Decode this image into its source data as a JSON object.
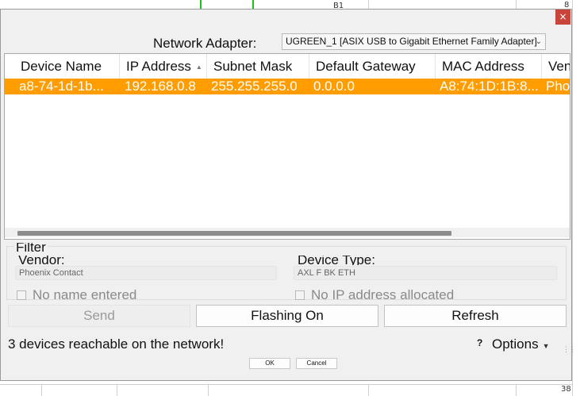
{
  "background": {
    "labels": [
      "B1",
      "8",
      "38"
    ]
  },
  "dialog": {
    "close_glyph": "×",
    "adapter_label": "Network Adapter:",
    "adapter_value": "UGREEN_1 [ASIX USB to Gigabit Ethernet Family Adapter]",
    "table": {
      "columns": [
        "Device Name",
        "IP Address",
        "Subnet Mask",
        "Default Gateway",
        "MAC Address",
        "Ven"
      ],
      "sorted_column": "IP Address",
      "rows": [
        {
          "device_name": "a8-74-1d-1b...",
          "ip_address": "192.168.0.8",
          "subnet_mask": "255.255.255.0",
          "default_gateway": "0.0.0.0",
          "mac_address": "A8:74:1D:1B:8...",
          "vendor": "Pho"
        }
      ],
      "selected_row_color": "#ff9c00"
    },
    "filter": {
      "title": "Filter",
      "vendor_label": "Vendor:",
      "vendor_value": "Phoenix Contact",
      "device_type_label": "Device Type:",
      "device_type_value": "AXL F BK ETH",
      "no_name_label": "No name entered",
      "no_ip_label": "No IP address allocated"
    },
    "buttons": {
      "send": "Send",
      "flashing": "Flashing On",
      "refresh": "Refresh"
    },
    "status": "3 devices reachable on the network!",
    "help_glyph": "?",
    "options_label": "Options",
    "ok": "OK",
    "cancel": "Cancel"
  }
}
